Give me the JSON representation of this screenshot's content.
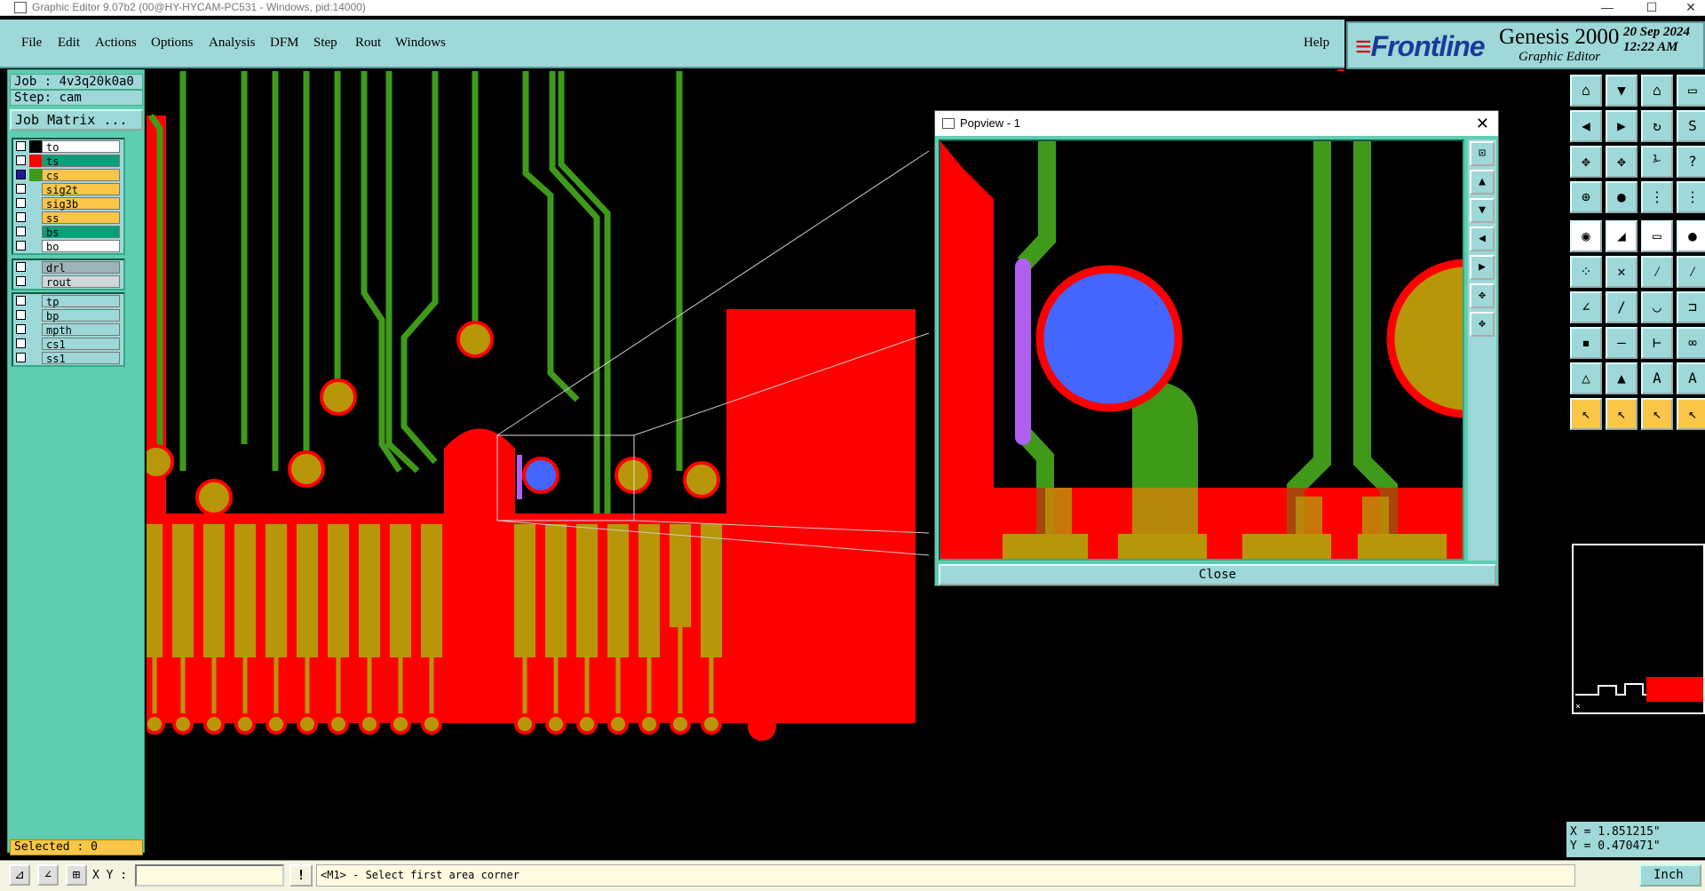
{
  "window": {
    "title": "Graphic Editor 9.07b2 (00@HY-HYCAM-PC531 - Windows, pid:14000)"
  },
  "menu": {
    "items": [
      "File",
      "Edit",
      "Actions",
      "Options",
      "Analysis",
      "DFM",
      "Step",
      "Rout",
      "Windows"
    ],
    "help": "Help"
  },
  "logo": {
    "brand": "Frontline",
    "product": "Genesis 2000",
    "subtitle": "Graphic Editor",
    "date": "20 Sep 2024",
    "time": "12:22 AM"
  },
  "job": {
    "job_line": "Job : 4v3q20k0a0",
    "step_line": "Step: cam",
    "matrix_button": "Job Matrix ..."
  },
  "layers": {
    "group1": [
      {
        "name": "to",
        "color": "#ffffff",
        "swatch": "#000000",
        "on": false
      },
      {
        "name": "ts",
        "color": "#0a9e7a",
        "swatch": "#ff0000",
        "on": false
      },
      {
        "name": "cs",
        "color": "#f9c64a",
        "swatch": "#3f9a1a",
        "on": true
      },
      {
        "name": "sig2t",
        "color": "#f9c64a",
        "swatch": "#9fd8d8",
        "on": false
      },
      {
        "name": "sig3b",
        "color": "#f9c64a",
        "swatch": "#9fd8d8",
        "on": false
      },
      {
        "name": "ss",
        "color": "#f9c64a",
        "swatch": "#9fd8d8",
        "on": false
      },
      {
        "name": "bs",
        "color": "#0a9e7a",
        "swatch": "#9fd8d8",
        "on": false
      },
      {
        "name": "bo",
        "color": "#ffffff",
        "swatch": "#9fd8d8",
        "on": false
      }
    ],
    "group2": [
      {
        "name": "drl",
        "color": "#9fb4b8",
        "swatch": "#9fd8d8",
        "on": false
      },
      {
        "name": "rout",
        "color": "#cfd8d8",
        "swatch": "#9fd8d8",
        "on": false
      }
    ],
    "group3": [
      {
        "name": "tp",
        "color": "#9fd8d8",
        "swatch": "#9fd8d8",
        "on": false
      },
      {
        "name": "bp",
        "color": "#9fd8d8",
        "swatch": "#9fd8d8",
        "on": false
      },
      {
        "name": "mpth",
        "color": "#9fd8d8",
        "swatch": "#9fd8d8",
        "on": false
      },
      {
        "name": "cs1",
        "color": "#9fd8d8",
        "swatch": "#9fd8d8",
        "on": false
      },
      {
        "name": "ss1",
        "color": "#9fd8d8",
        "swatch": "#9fd8d8",
        "on": false
      }
    ]
  },
  "selected": "Selected : 0",
  "bottom": {
    "xy_label": "X Y :",
    "xy_value": "",
    "stop": "!",
    "prompt": "<M1> - Select first area corner",
    "unit": "Inch"
  },
  "coords": {
    "x": "X = 1.851215\"",
    "y": "Y = 0.470471\""
  },
  "popview": {
    "title": "Popview - 1",
    "close": "Close"
  },
  "colors": {
    "pad_red": "#ff0000",
    "trace_green": "#3f9a1a",
    "copper_gold": "#b8960a",
    "via_blue": "#4466ff",
    "ui_cyan": "#9fd8d8",
    "panel_teal": "#5fcdb0"
  }
}
